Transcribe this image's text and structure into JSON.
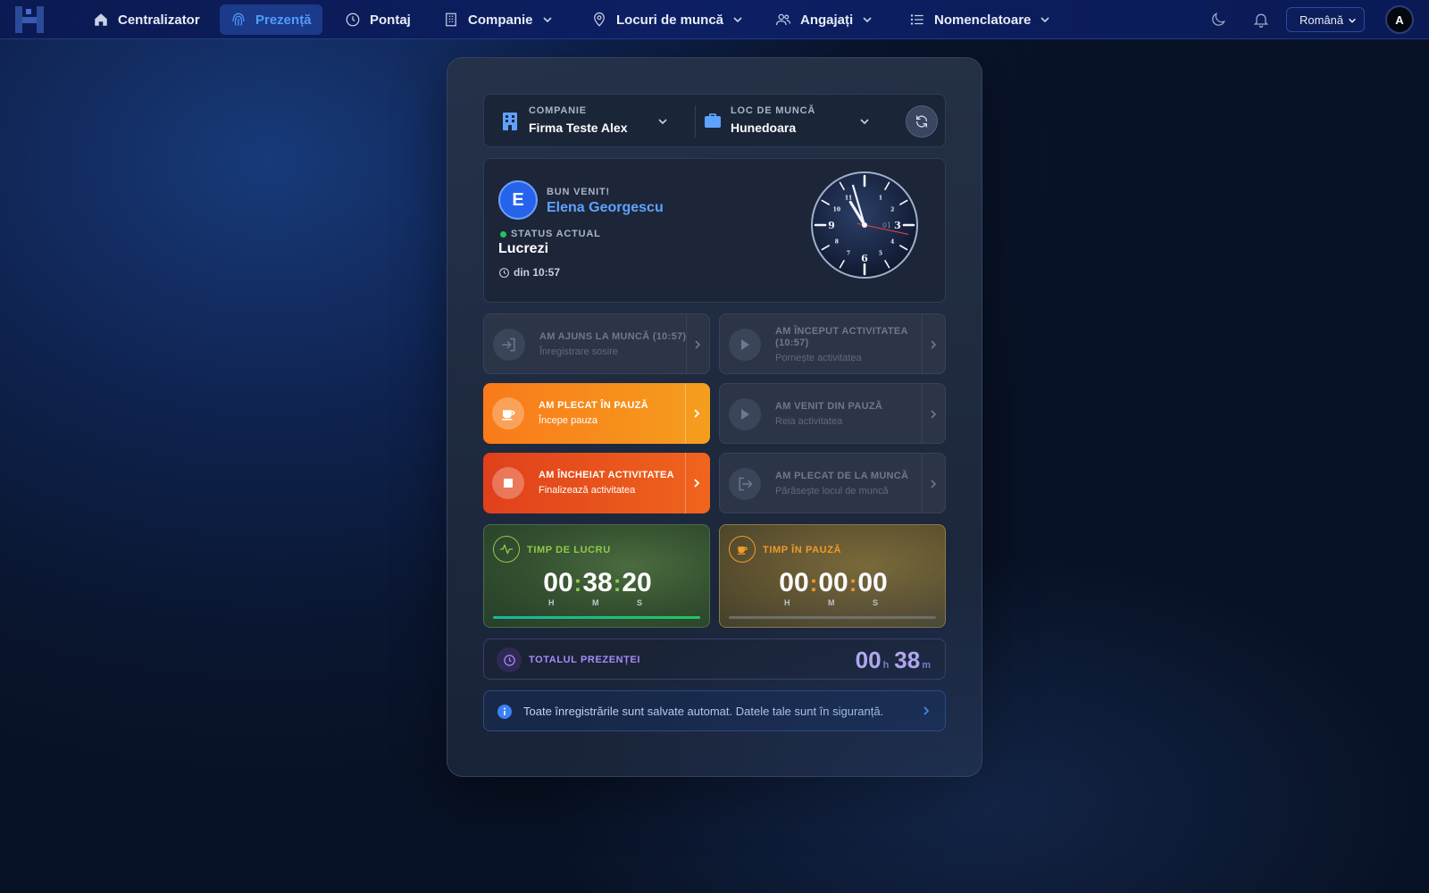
{
  "nav": {
    "items": [
      {
        "label": "Centralizator",
        "icon": "home-icon"
      },
      {
        "label": "Prezență",
        "icon": "fingerprint-icon",
        "active": true
      },
      {
        "label": "Pontaj",
        "icon": "clock-icon"
      },
      {
        "label": "Companie",
        "icon": "building-icon",
        "dropdown": true
      },
      {
        "label": "Locuri de muncă",
        "icon": "map-pin-icon",
        "dropdown": true
      },
      {
        "label": "Angajați",
        "icon": "users-icon",
        "dropdown": true
      },
      {
        "label": "Nomenclatoare",
        "icon": "list-icon",
        "dropdown": true
      }
    ],
    "language": "Română",
    "avatar_initial": "A"
  },
  "selector": {
    "company_label": "COMPANIE",
    "company_value": "Firma Teste Alex",
    "location_label": "LOC DE MUNCĂ",
    "location_value": "Hunedoara"
  },
  "welcome": {
    "avatar_initial": "E",
    "greeting": "BUN VENIT!",
    "name": "Elena Georgescu",
    "status_label": "STATUS ACTUAL",
    "status_value": "Lucrezi",
    "since": "din 10:57",
    "clock": {
      "hour": 10,
      "minute": 57,
      "second": 17,
      "numerals": [
        "1",
        "2",
        "3",
        "4",
        "5",
        "6",
        "7",
        "8",
        "9",
        "10",
        "11"
      ],
      "date_label": "01"
    }
  },
  "actions": [
    {
      "title": "AM AJUNS LA MUNCĂ (10:57)",
      "subtitle": "Înregistrare sosire",
      "state": "disabled",
      "icon": "login-icon"
    },
    {
      "title": "AM ÎNCEPUT ACTIVITATEA (10:57)",
      "subtitle": "Pornește activitatea",
      "state": "disabled",
      "icon": "play-icon"
    },
    {
      "title": "AM PLECAT ÎN PAUZĂ",
      "subtitle": "Începe pauza",
      "state": "orange",
      "icon": "coffee-icon"
    },
    {
      "title": "AM VENIT DIN PAUZĂ",
      "subtitle": "Reia activitatea",
      "state": "disabled",
      "icon": "play-icon"
    },
    {
      "title": "AM ÎNCHEIAT ACTIVITATEA",
      "subtitle": "Finalizează activitatea",
      "state": "red",
      "icon": "stop-icon"
    },
    {
      "title": "AM PLECAT DE LA MUNCĂ",
      "subtitle": "Părăsește locul de muncă",
      "state": "disabled",
      "icon": "logout-icon"
    }
  ],
  "timers": {
    "work": {
      "label": "TIMP DE LUCRU",
      "h": "00",
      "m": "38",
      "s": "20",
      "progress": 1.0
    },
    "pause": {
      "label": "TIMP ÎN PAUZĂ",
      "h": "00",
      "m": "00",
      "s": "00",
      "progress": 0
    },
    "unit_h": "H",
    "unit_m": "M",
    "unit_s": "S"
  },
  "total": {
    "label": "TOTALUL PREZENȚEI",
    "hours": "00",
    "hours_unit": "h",
    "minutes": "38",
    "minutes_unit": "m"
  },
  "info": {
    "text": "Toate înregistrările sunt salvate automat. Datele tale sunt în siguranță."
  },
  "colors": {
    "accent": "#4f9cff",
    "work": "#8ecb4a",
    "pause": "#f39a2a",
    "total": "#a78bfa",
    "status": "#22c55e"
  }
}
